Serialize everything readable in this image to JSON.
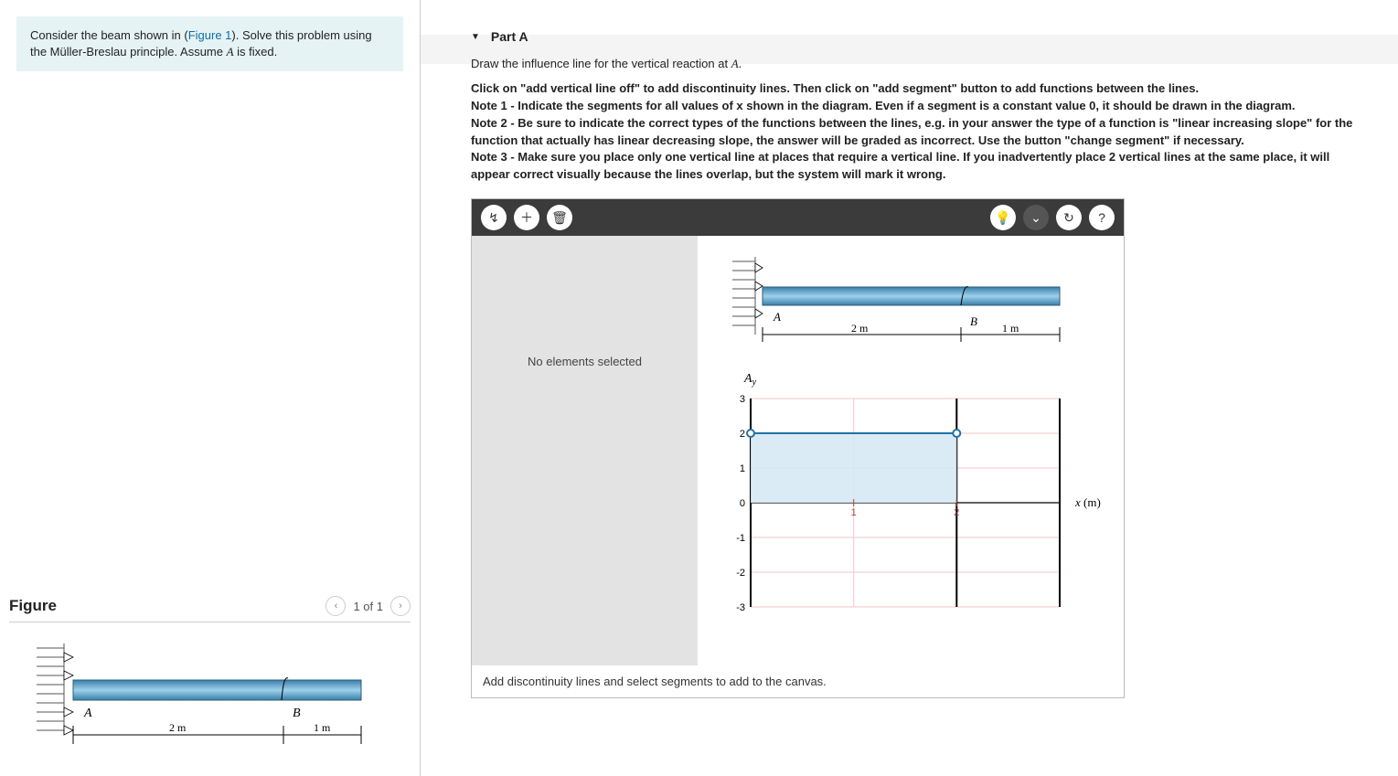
{
  "problem": {
    "text_before_link": "Consider the beam shown in (",
    "figure_link": "Figure 1",
    "text_after_link": "). Solve this problem using the Müller-Breslau principle. Assume ",
    "A_var": "A",
    "text_tail": " is fixed."
  },
  "figure_panel": {
    "title": "Figure",
    "counter": "1 of 1",
    "beam": {
      "label_A": "A",
      "label_B": "B",
      "dim1": "2 m",
      "dim2": "1 m"
    }
  },
  "part": {
    "label": "Part A",
    "prompt_before": "Draw the influence line for the vertical reaction at ",
    "prompt_var": "A",
    "prompt_after": ".",
    "instr_line1": "Click on \"add vertical line off\" to add discontinuity lines. Then click on \"add segment\" button to add functions between the lines.",
    "instr_note1": "Note 1 - Indicate the segments for all values of x shown in the diagram. Even if a segment is a constant value 0, it should be drawn in the diagram.",
    "instr_note2": "Note 2 - Be sure to indicate the correct types of the functions between the lines, e.g. in your answer the type of a function is \"linear increasing slope\" for the function that actually has linear decreasing slope, the answer will be graded as incorrect. Use the button \"change segment\" if necessary.",
    "instr_note3": "Note 3 - Make sure you place only one vertical line at places that require a vertical line. If you inadvertently place 2 vertical lines at the same place, it will appear correct visually because the lines overlap, but the system will mark it wrong."
  },
  "toolbar_icons": {
    "tool1": "↯",
    "add": "＋",
    "delete": "🗑",
    "hint": "💡",
    "expand": "⌄",
    "reset": "↻",
    "help": "?"
  },
  "canvas": {
    "side_msg": "No elements selected",
    "bottom_msg": "Add discontinuity lines and select segments to add to the canvas.",
    "beam": {
      "label_A": "A",
      "label_B": "B",
      "dim1": "2 m",
      "dim2": "1 m"
    }
  },
  "chart_data": {
    "type": "line",
    "title": "Aᵧ",
    "xlabel": "x (m)",
    "ylabel": "",
    "xlim": [
      0,
      3
    ],
    "ylim": [
      -3,
      3
    ],
    "x_ticks": [
      1,
      2
    ],
    "y_ticks": [
      -3,
      -2,
      -1,
      0,
      1,
      2,
      3
    ],
    "vertical_markers": [
      0,
      2,
      3
    ],
    "series": [
      {
        "name": "segment",
        "x": [
          0,
          2
        ],
        "y": [
          2,
          2
        ],
        "style": "line-with-endpoints"
      }
    ],
    "shaded_region": {
      "x": [
        0,
        2
      ],
      "y_from": 0,
      "y_to": 2
    }
  }
}
